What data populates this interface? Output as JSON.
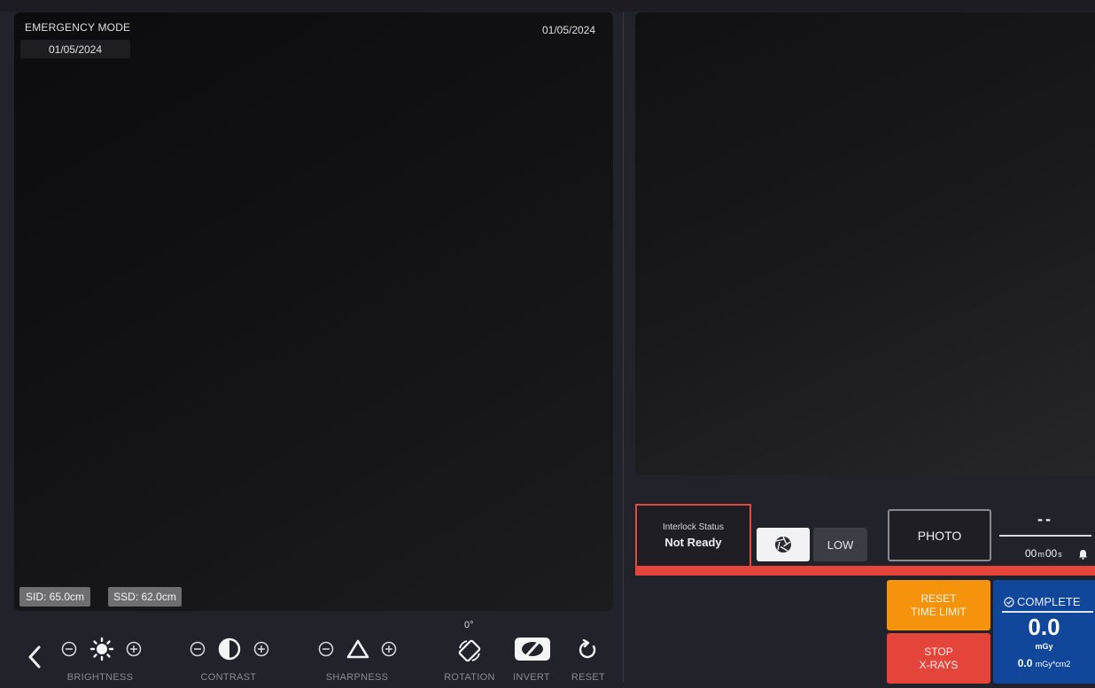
{
  "header": {
    "mode": "EMERGENCY MODE",
    "date_left": "01/05/2024",
    "date_right": "01/05/2024"
  },
  "image_overlay": {
    "sid": "SID: 65.0cm",
    "ssd": "SSD: 62.0cm"
  },
  "toolbar": {
    "back_icon": "chevron-left-icon",
    "brightness": {
      "label": "BRIGHTNESS",
      "icon": "sun-icon"
    },
    "contrast": {
      "label": "CONTRAST",
      "icon": "half-circle-icon"
    },
    "sharpness": {
      "label": "SHARPNESS",
      "icon": "triangle-icon"
    },
    "rotation": {
      "label": "ROTATION",
      "value": "0°",
      "icon": "rotate-icon"
    },
    "invert": {
      "label": "INVERT",
      "icon": "invert-icon"
    },
    "reset": {
      "label": "RESET",
      "icon": "reset-icon"
    }
  },
  "controls": {
    "interlock_title": "Interlock Status",
    "interlock_value": "Not Ready",
    "shutter_icon": "aperture-icon",
    "dose_level": "LOW",
    "photo_label": "PHOTO",
    "dose_placeholder": "--",
    "timer_min": "00",
    "timer_min_unit": "m",
    "timer_sec": "00",
    "timer_sec_unit": "s",
    "reset_limit_line1": "RESET",
    "reset_limit_line2": "TIME LIMIT",
    "stop_line1": "STOP",
    "stop_line2": "X-RAYS",
    "complete_label": "COMPLETE",
    "dose_value": "0.0",
    "dose_unit": "mGy",
    "dap_value": "0.0",
    "dap_unit": "mGy*cm2"
  },
  "colors": {
    "accent_red": "#e5443a",
    "accent_orange": "#f5930c",
    "accent_blue": "#10479a"
  }
}
